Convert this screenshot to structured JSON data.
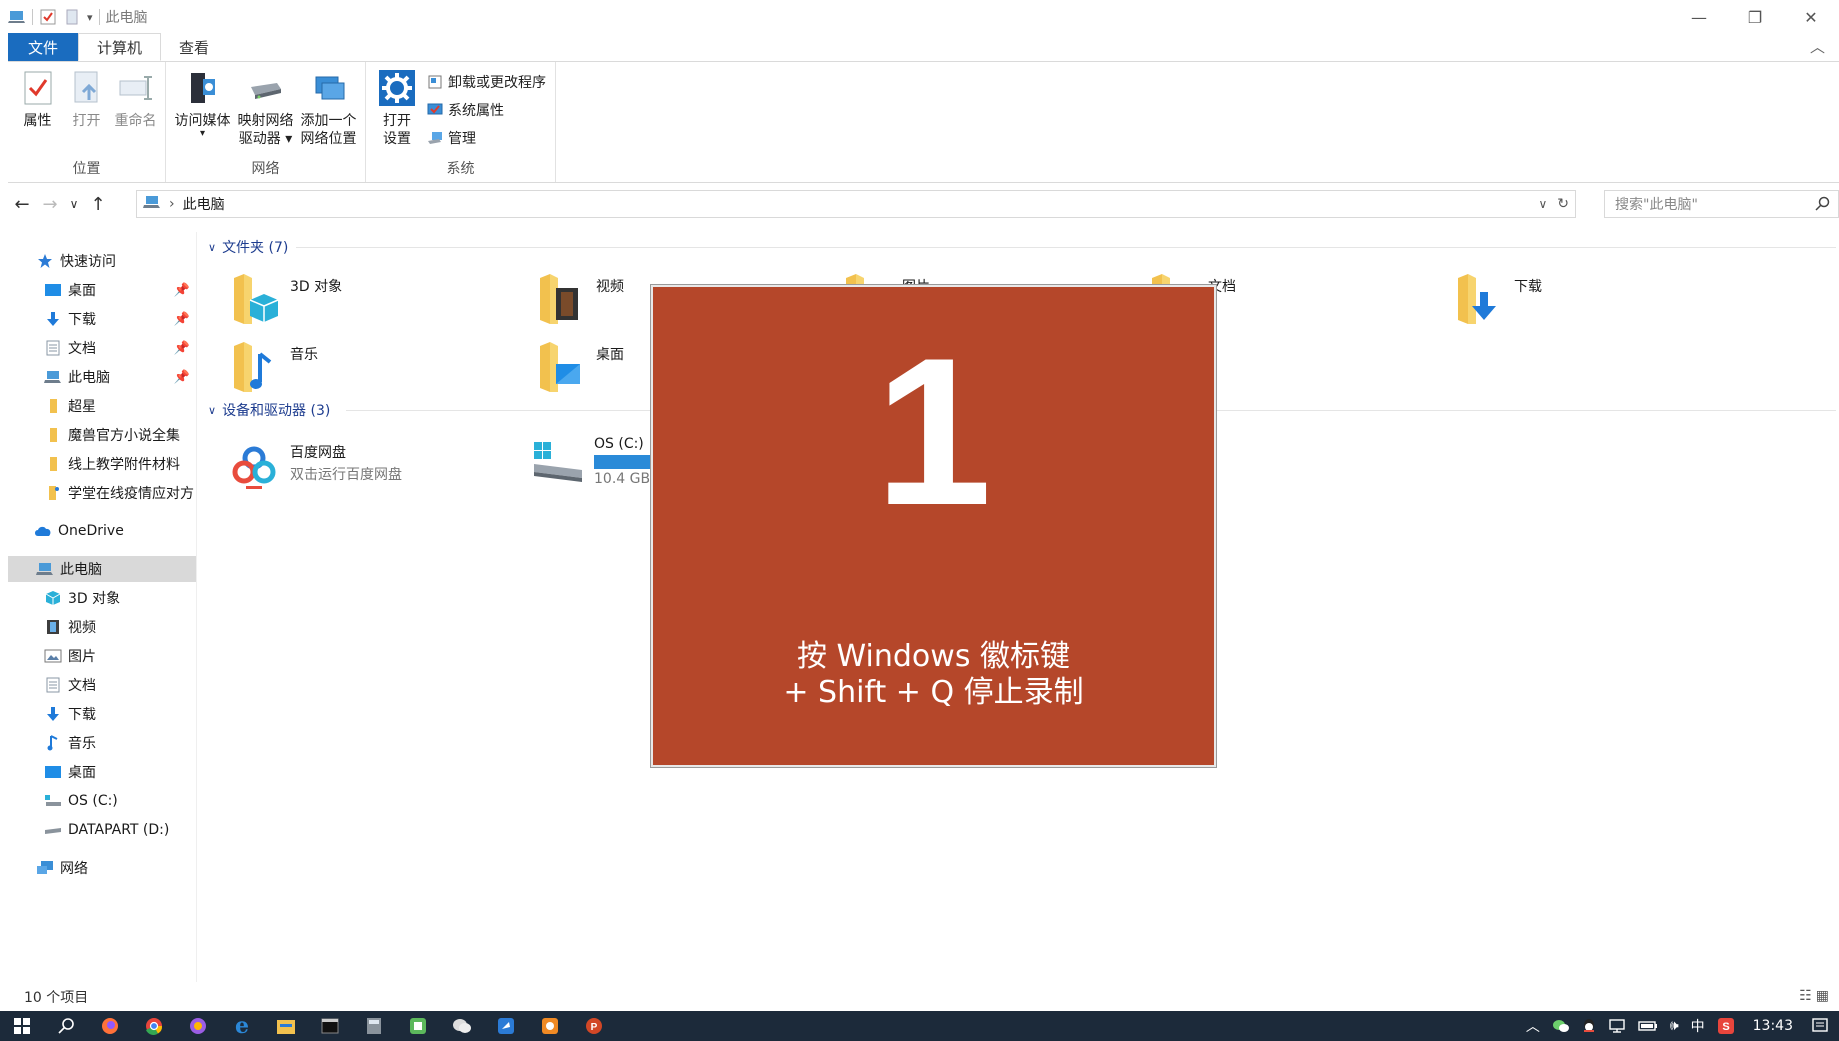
{
  "window": {
    "title": "此电脑",
    "controls": [
      "—",
      "❐",
      "✕"
    ]
  },
  "tabs": [
    {
      "label": "文件"
    },
    {
      "label": "计算机"
    },
    {
      "label": "查看"
    }
  ],
  "ribbon": {
    "location": {
      "label": "位置",
      "buttons": [
        {
          "label": "属性"
        },
        {
          "label": "打开"
        },
        {
          "label": "重命名"
        }
      ]
    },
    "network": {
      "label": "网络",
      "buttons": [
        {
          "label": "访问媒体"
        },
        {
          "label": "映射网络",
          "label2": "驱动器 ▾"
        },
        {
          "label": "添加一个",
          "label2": "网络位置"
        }
      ]
    },
    "system": {
      "label": "系统",
      "open_settings": {
        "label": "打开",
        "label2": "设置"
      },
      "small": [
        {
          "label": "卸载或更改程序"
        },
        {
          "label": "系统属性"
        },
        {
          "label": "管理"
        }
      ]
    }
  },
  "address": {
    "path": "此电脑",
    "search_placeholder": "搜索\"此电脑\""
  },
  "nav": {
    "quick_access": "快速访问",
    "items": [
      {
        "label": "桌面",
        "pinned": true
      },
      {
        "label": "下载",
        "pinned": true
      },
      {
        "label": "文档",
        "pinned": true
      },
      {
        "label": "此电脑",
        "pinned": true
      },
      {
        "label": "超星"
      },
      {
        "label": "魔兽官方小说全集"
      },
      {
        "label": "线上教学附件材料"
      },
      {
        "label": "学堂在线疫情应对方"
      }
    ],
    "onedrive": "OneDrive",
    "this_pc": "此电脑",
    "pc_items": [
      {
        "label": "3D 对象"
      },
      {
        "label": "视频"
      },
      {
        "label": "图片"
      },
      {
        "label": "文档"
      },
      {
        "label": "下载"
      },
      {
        "label": "音乐"
      },
      {
        "label": "桌面"
      },
      {
        "label": "OS (C:)"
      },
      {
        "label": "DATAPART (D:)"
      }
    ],
    "network": "网络"
  },
  "content": {
    "folders_header": "文件夹 (7)",
    "folders": [
      {
        "name": "3D 对象"
      },
      {
        "name": "视频"
      },
      {
        "name": "图片"
      },
      {
        "name": "文档"
      },
      {
        "name": "下载"
      },
      {
        "name": "音乐"
      },
      {
        "name": "桌面"
      }
    ],
    "devices_header": "设备和驱动器 (3)",
    "devices": [
      {
        "name": "百度网盘",
        "sub": "双击运行百度网盘"
      },
      {
        "name": "OS (C:)",
        "sub": "10.4 GB"
      }
    ]
  },
  "overlay": {
    "number": "1",
    "line1": "按 Windows 徽标键",
    "line2": "+ Shift + Q 停止录制",
    "color": "#b5472a"
  },
  "status": {
    "items_count": "10 个项目"
  },
  "taskbar": {
    "tray_ime": "中",
    "clock": "13:43"
  }
}
